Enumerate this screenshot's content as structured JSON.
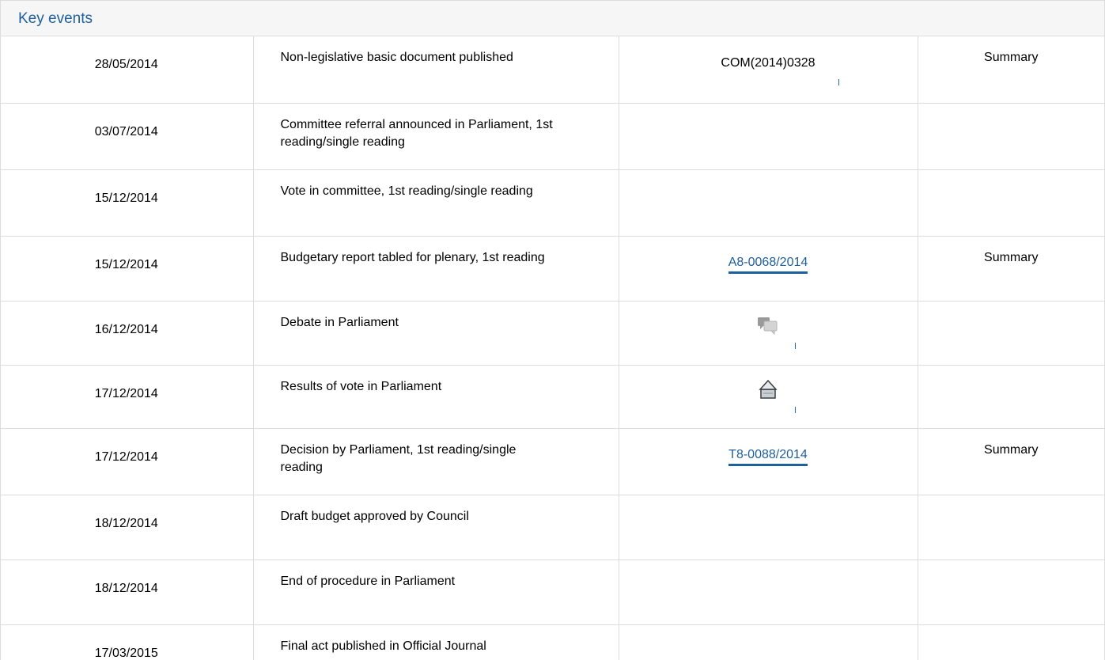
{
  "panel": {
    "title": "Key events"
  },
  "colors": {
    "title": "#1f5f9b",
    "link": "#1f5f9b",
    "border": "#dddddd",
    "header_bg": "#f6f6f6"
  },
  "rows": [
    {
      "date": "28/05/2014",
      "event": "Non-legislative basic document published",
      "doc": "COM(2014)0328",
      "summary": "Summary"
    },
    {
      "date": "03/07/2014",
      "event": "Committee referral announced in Parliament, 1st reading/single reading",
      "doc": "",
      "summary": ""
    },
    {
      "date": "15/12/2014",
      "event": "Vote in committee, 1st reading/single reading",
      "doc": "",
      "summary": ""
    },
    {
      "date": "15/12/2014",
      "event": "Budgetary report tabled for plenary, 1st reading",
      "doc": "A8-0068/2014",
      "summary": "Summary"
    },
    {
      "date": "16/12/2014",
      "event": "Debate in Parliament",
      "doc_icon": "debate-speech-bubbles-icon",
      "summary": ""
    },
    {
      "date": "17/12/2014",
      "event": "Results of vote in Parliament",
      "doc_icon": "ballot-box-icon",
      "summary": ""
    },
    {
      "date": "17/12/2014",
      "event": "Decision by Parliament, 1st reading/single reading",
      "doc": "T8-0088/2014",
      "summary": "Summary"
    },
    {
      "date": "18/12/2014",
      "event": "Draft budget approved by Council",
      "doc": "",
      "summary": ""
    },
    {
      "date": "18/12/2014",
      "event": "End of procedure in Parliament",
      "doc": "",
      "summary": ""
    },
    {
      "date": "17/03/2015",
      "event": "Final act published in Official Journal",
      "doc": "",
      "summary": ""
    }
  ]
}
